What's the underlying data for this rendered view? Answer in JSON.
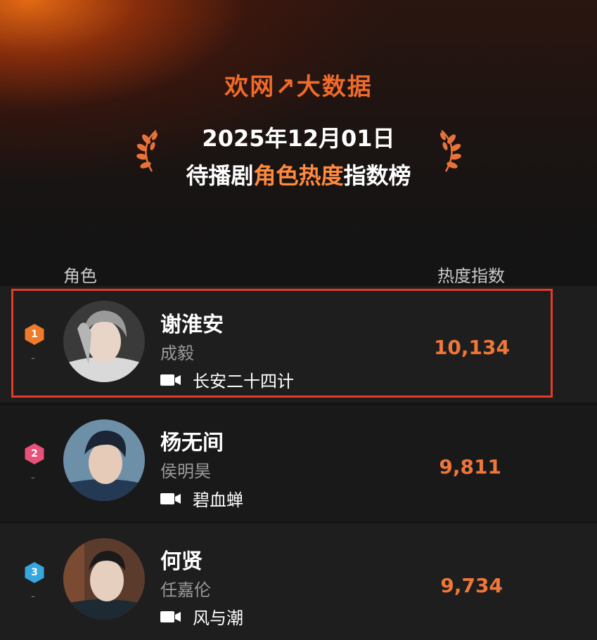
{
  "header": {
    "brand": "欢网↗大数据",
    "date": "2025年12月01日",
    "subtitle_prefix": "待播剧",
    "subtitle_highlight": "角色热度",
    "subtitle_suffix": "指数榜"
  },
  "columns": {
    "role": "角色",
    "index": "热度指数"
  },
  "rows": [
    {
      "rank": "1",
      "change": "-",
      "name": "谢淮安",
      "actor": "成毅",
      "show": "长安二十四计",
      "score": "10,134",
      "badge_color": "#ee7a2a"
    },
    {
      "rank": "2",
      "change": "-",
      "name": "杨无间",
      "actor": "侯明昊",
      "show": "碧血蝉",
      "score": "9,811",
      "badge_color": "#e9507a"
    },
    {
      "rank": "3",
      "change": "-",
      "name": "何贤",
      "actor": "任嘉伦",
      "show": "风与潮",
      "score": "9,734",
      "badge_color": "#36a6df"
    }
  ],
  "icons": {
    "show": "video-camera-icon",
    "laurel": "laurel-icon"
  },
  "colors": {
    "accent": "#f0763a",
    "highlight_border": "#e53b2a"
  }
}
